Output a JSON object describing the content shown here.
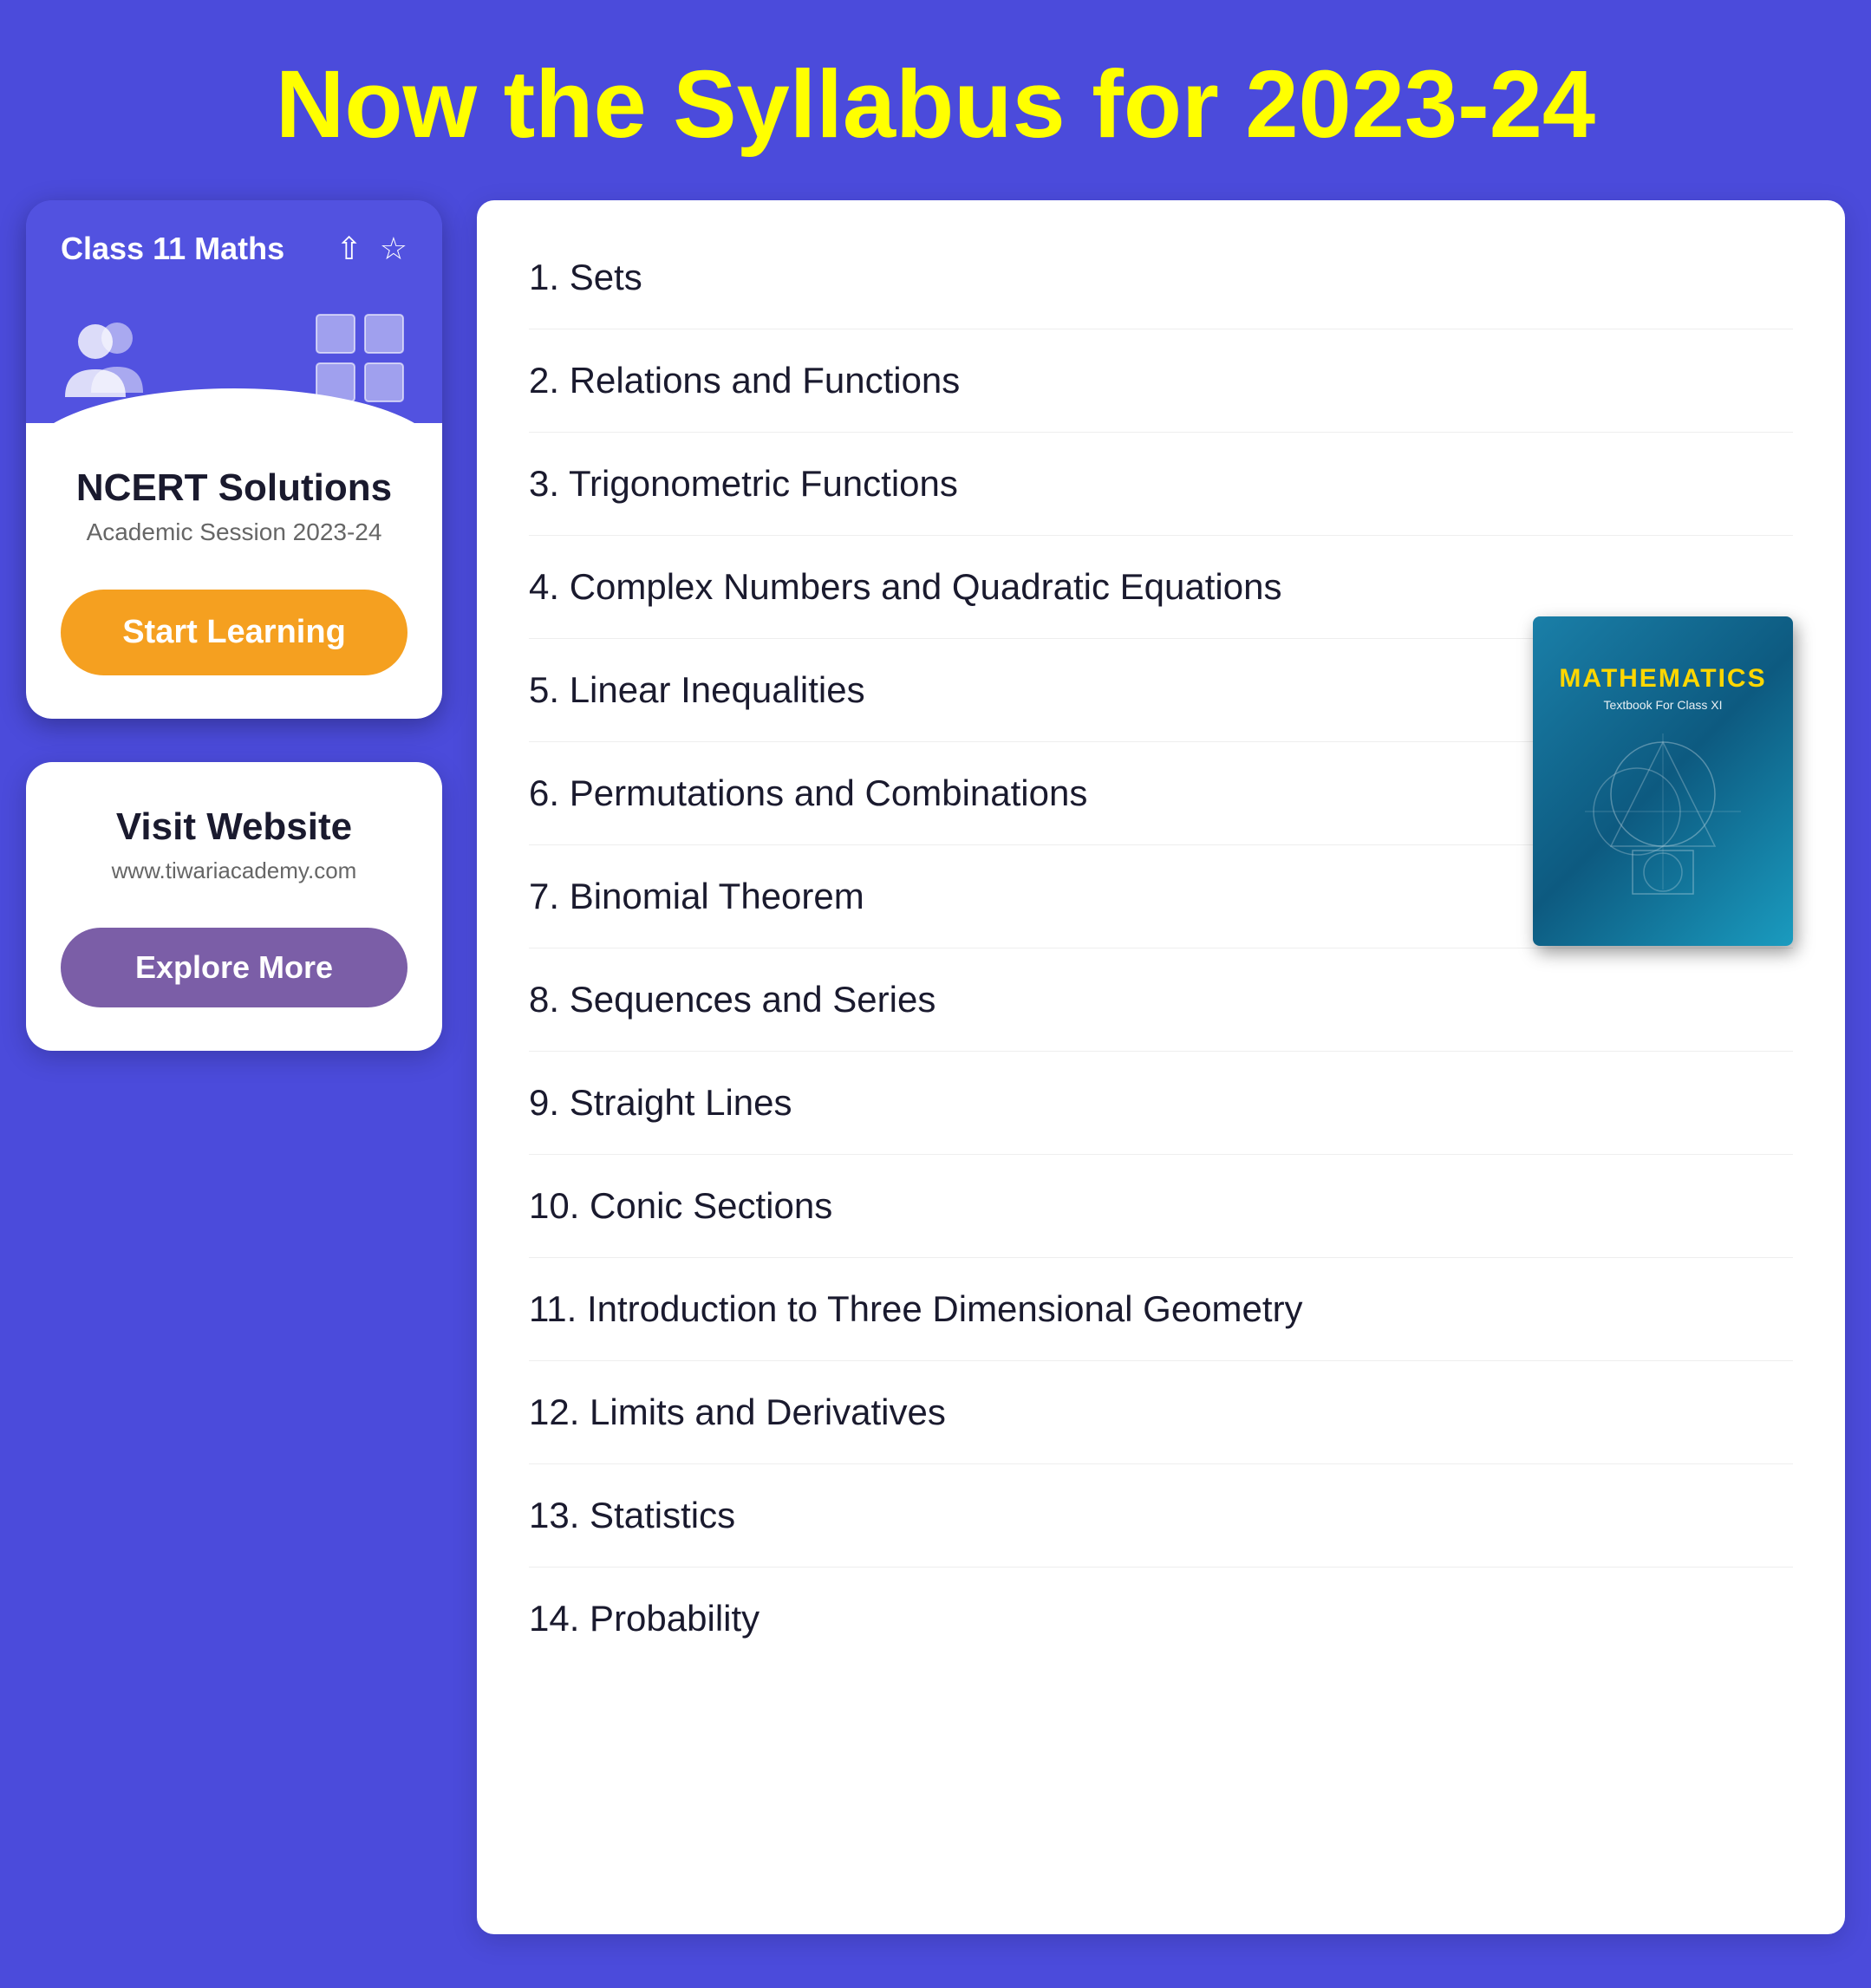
{
  "header": {
    "title": "Now the Syllabus for 2023-24"
  },
  "left": {
    "app_card": {
      "title": "Class 11 Maths",
      "share_icon": "share",
      "star_icon": "star"
    },
    "ncert_card": {
      "title": "NCERT Solutions",
      "subtitle": "Academic Session 2023-24",
      "button_label": "Start Learning"
    },
    "website_card": {
      "title": "Visit Website",
      "url": "www.tiwariacademy.com",
      "button_label": "Explore More"
    }
  },
  "right": {
    "chapters": [
      "1. Sets",
      "2. Relations and Functions",
      "3. Trigonometric Functions",
      "4. Complex Numbers and Quadratic Equations",
      "5. Linear Inequalities",
      "6. Permutations and Combinations",
      "7. Binomial Theorem",
      "8. Sequences and Series",
      "9. Straight Lines",
      "10. Conic Sections",
      "11. Introduction to Three Dimensional Geometry",
      "12. Limits and Derivatives",
      "13. Statistics",
      "14. Probability"
    ],
    "book": {
      "title": "MATHEMATICS",
      "subtitle": "Textbook For Class XI"
    }
  }
}
